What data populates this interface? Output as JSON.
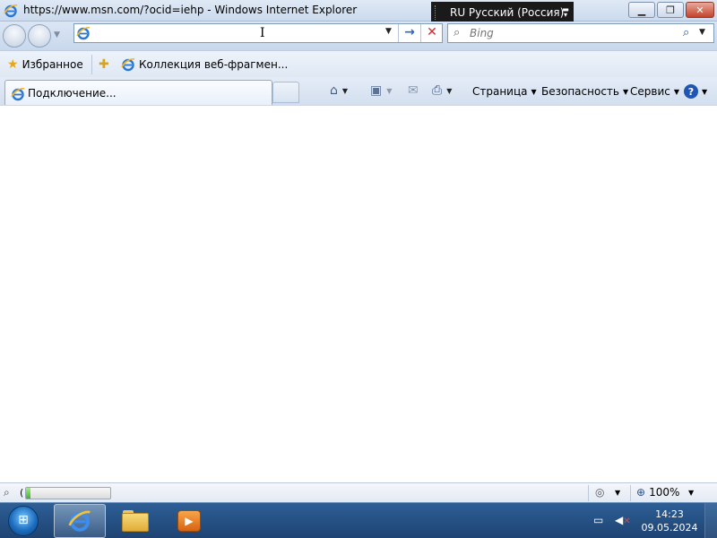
{
  "window": {
    "title": "https://www.msn.com/?ocid=iehp - Windows Internet Explorer",
    "minimize_icon": "minimize-icon",
    "restore_icon": "restore-icon",
    "close_icon": "close-icon"
  },
  "language_bar": {
    "text": "RU Русский (Россия)"
  },
  "address": {
    "value": "",
    "placeholder": ""
  },
  "search": {
    "placeholder": "Bing"
  },
  "favorites_bar": {
    "favorites_label": "Избранное",
    "web_slice_label": "Коллекция веб-фрагмен..."
  },
  "tabs": [
    {
      "label": "Подключение..."
    }
  ],
  "command_bar": {
    "page_label": "Страница",
    "safety_label": "Безопасность",
    "tools_label": "Сервис"
  },
  "status_bar": {
    "text": "(",
    "progress": 0.05,
    "zoom": "100%"
  },
  "taskbar": {
    "time": "14:23",
    "date": "09.05.2024"
  },
  "colors": {
    "accent": "#1f56b3",
    "go_arrow": "#2a66c9",
    "stop": "#d6262d",
    "progress_green": "#3fb42a"
  }
}
